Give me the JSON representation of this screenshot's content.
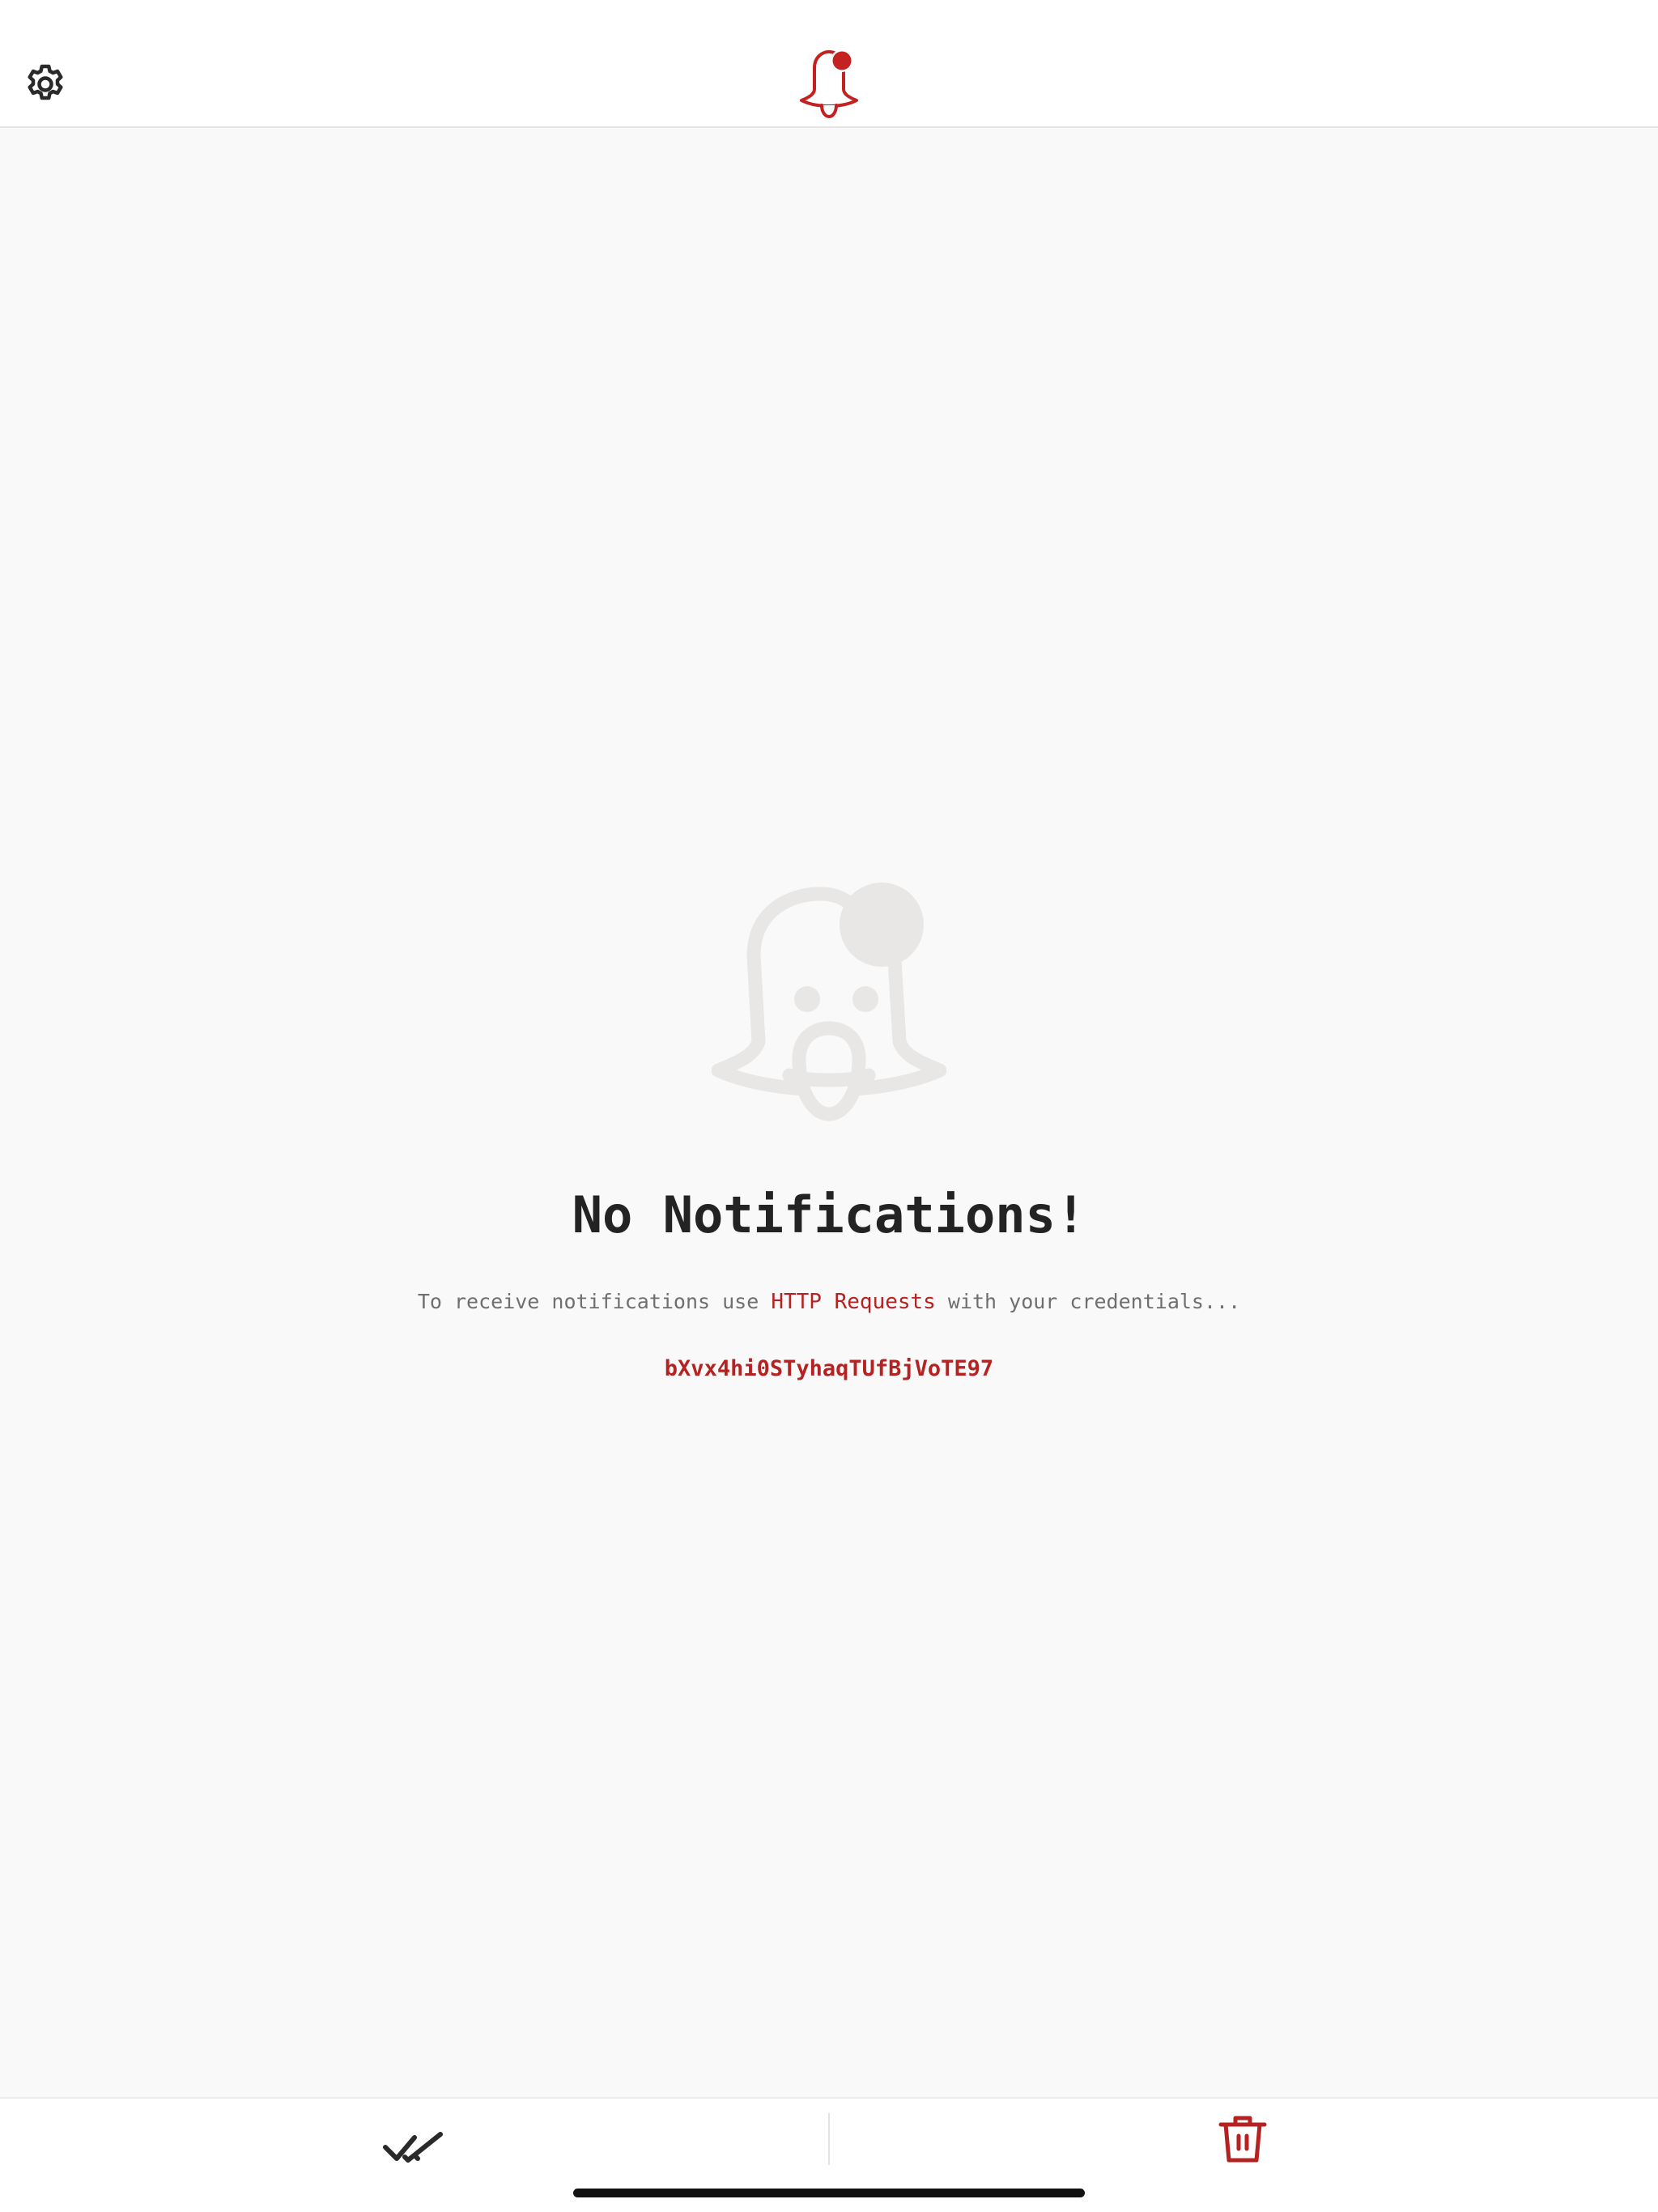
{
  "header": {
    "settings_icon": "gear-icon",
    "app_icon": "bell-with-badge-icon"
  },
  "empty_state": {
    "illustration_icon": "bell-face-icon",
    "title": "No Notifications!",
    "message_before": "To receive notifications use ",
    "message_link": "HTTP Requests",
    "message_after": " with your credentials...",
    "credential_token": "bXvx4hi0STyhaqTUfBjVoTE97"
  },
  "footer": {
    "mark_all_read_icon": "double-check-icon",
    "delete_all_icon": "trash-icon"
  },
  "colors": {
    "accent": "#b52222",
    "text_dark": "#232323",
    "text_muted": "#6f6f6f",
    "background": "#f9f9f9",
    "surface": "#ffffff",
    "illustration": "#e8e7e6"
  }
}
